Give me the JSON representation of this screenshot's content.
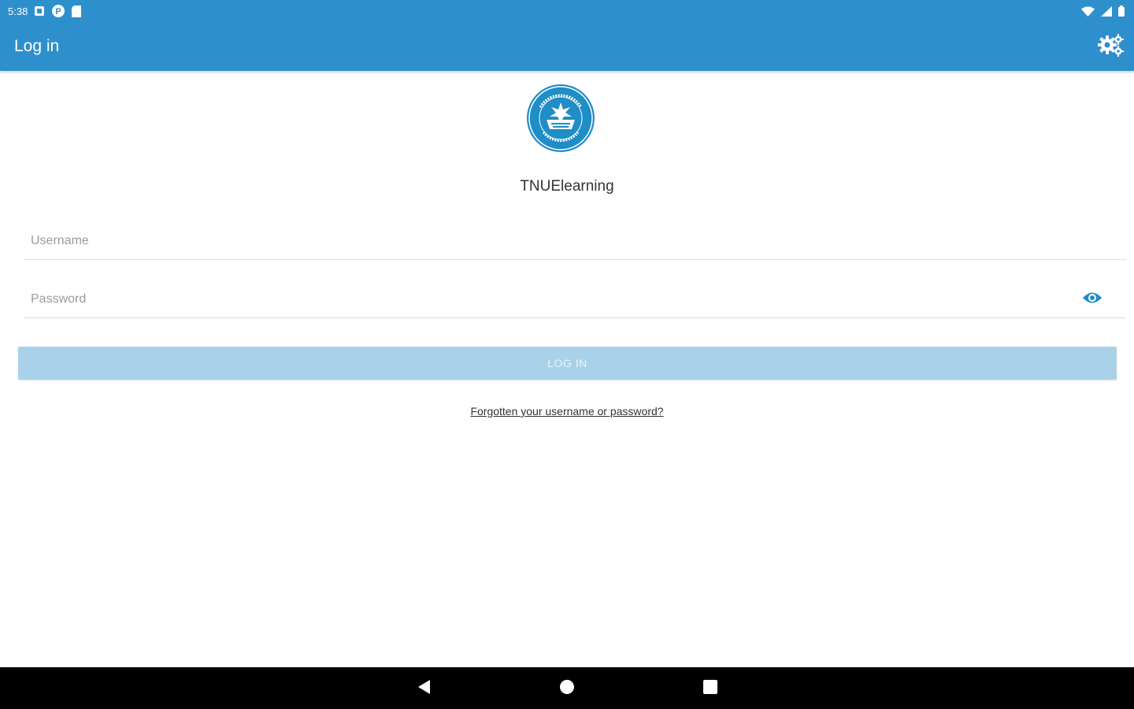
{
  "status_bar": {
    "time": "5:38",
    "left_icons": [
      "notification-box-icon",
      "p-badge-icon",
      "sd-card-icon"
    ],
    "right_icons": [
      "wifi-icon",
      "signal-icon",
      "battery-icon"
    ]
  },
  "app_bar": {
    "title": "Log in",
    "settings_icon": "gears-icon"
  },
  "login": {
    "site_name": "TNUElearning",
    "username_placeholder": "Username",
    "password_placeholder": "Password",
    "password_toggle_icon": "eye-icon",
    "login_button": "LOG IN",
    "forgot_link": "Forgotten your username or password?"
  },
  "nav_bar": {
    "icons": [
      "back-icon",
      "home-icon",
      "recents-icon"
    ]
  },
  "colors": {
    "primary": "#2e8fcd",
    "button_disabled": "#a9d2ea",
    "nav_bg": "#000000"
  }
}
